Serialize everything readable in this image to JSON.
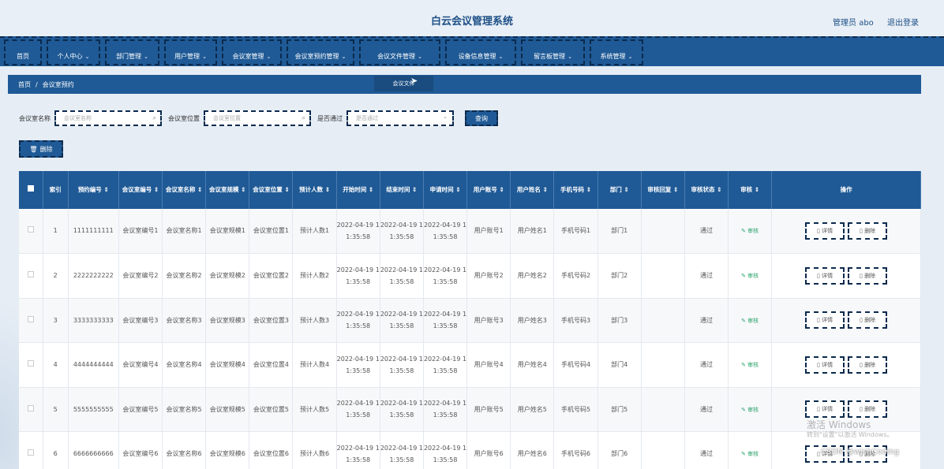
{
  "app": {
    "title": "白云会议管理系统"
  },
  "user": {
    "name": "管理员 abo",
    "logout": "退出登录"
  },
  "nav": [
    {
      "label": "首页",
      "chev": ""
    },
    {
      "label": "个人中心",
      "chev": "⌄"
    },
    {
      "label": "部门管理",
      "chev": "⌄"
    },
    {
      "label": "用户管理",
      "chev": "⌄"
    },
    {
      "label": "会议室管理",
      "chev": "⌄"
    },
    {
      "label": "会议室预约管理",
      "chev": "⌄"
    },
    {
      "label": "会议文件管理",
      "chev": "⌄"
    },
    {
      "label": "设备信息管理",
      "chev": "⌄"
    },
    {
      "label": "留言板管理",
      "chev": "⌄"
    },
    {
      "label": "系统管理",
      "chev": "⌄"
    }
  ],
  "breadcrumb": {
    "home": "首页",
    "sep": "/",
    "current": "会议室预约"
  },
  "hover_tip": "会议文件",
  "search": {
    "name_label": "会议室名称",
    "name_placeholder": "会议室名称",
    "loc_label": "会议室位置",
    "loc_placeholder": "会议室位置",
    "pass_label": "是否通过",
    "pass_placeholder": "是否通过",
    "button": "查询"
  },
  "delete_button": "删除",
  "table": {
    "headers": [
      "索引",
      "预约编号",
      "会议室编号",
      "会议室名称",
      "会议室规模",
      "会议室位置",
      "预计人数",
      "开始时间",
      "结束时间",
      "申请时间",
      "用户账号",
      "用户姓名",
      "手机号码",
      "部门",
      "审核回复",
      "审核状态",
      "审核",
      "操作"
    ],
    "rows": [
      [
        "1",
        "1111111111",
        "会议室编号1",
        "会议室名称1",
        "会议室规模1",
        "会议室位置1",
        "预计人数1",
        "2022-04-19 11:35:58",
        "2022-04-19 11:35:58",
        "2022-04-19 11:35:58",
        "用户账号1",
        "用户姓名1",
        "手机号码1",
        "部门1",
        "",
        "通过",
        "审核"
      ],
      [
        "2",
        "2222222222",
        "会议室编号2",
        "会议室名称2",
        "会议室规模2",
        "会议室位置2",
        "预计人数2",
        "2022-04-19 11:35:58",
        "2022-04-19 11:35:58",
        "2022-04-19 11:35:58",
        "用户账号2",
        "用户姓名2",
        "手机号码2",
        "部门2",
        "",
        "通过",
        "审核"
      ],
      [
        "3",
        "3333333333",
        "会议室编号3",
        "会议室名称3",
        "会议室规模3",
        "会议室位置3",
        "预计人数3",
        "2022-04-19 11:35:58",
        "2022-04-19 11:35:58",
        "2022-04-19 11:35:58",
        "用户账号3",
        "用户姓名3",
        "手机号码3",
        "部门3",
        "",
        "通过",
        "审核"
      ],
      [
        "4",
        "4444444444",
        "会议室编号4",
        "会议室名称4",
        "会议室规模4",
        "会议室位置4",
        "预计人数4",
        "2022-04-19 11:35:58",
        "2022-04-19 11:35:58",
        "2022-04-19 11:35:58",
        "用户账号4",
        "用户姓名4",
        "手机号码4",
        "部门4",
        "",
        "通过",
        "审核"
      ],
      [
        "5",
        "5555555555",
        "会议室编号5",
        "会议室名称5",
        "会议室规模5",
        "会议室位置5",
        "预计人数5",
        "2022-04-19 11:35:58",
        "2022-04-19 11:35:58",
        "2022-04-19 11:35:58",
        "用户账号5",
        "用户姓名5",
        "手机号码5",
        "部门5",
        "",
        "通过",
        "审核"
      ],
      [
        "6",
        "6666666666",
        "会议室编号6",
        "会议室名称6",
        "会议室规模6",
        "会议室位置6",
        "预计人数6",
        "2022-04-19 11:35:58",
        "2022-04-19 11:35:58",
        "2022-04-19 11:35:58",
        "用户账号6",
        "用户姓名6",
        "手机号码6",
        "部门6",
        "",
        "通过",
        "审核"
      ]
    ],
    "detail_label": "详情",
    "delete_label": "删除"
  },
  "watermark": {
    "line1": "激活 Windows",
    "line2": "转到\"设置\"以激活 Windows。",
    "credit": "CSDN @wishCoding"
  },
  "colors": {
    "primary": "#1f5a96",
    "border": "#0b2a4d",
    "audit": "#2ba36a"
  }
}
